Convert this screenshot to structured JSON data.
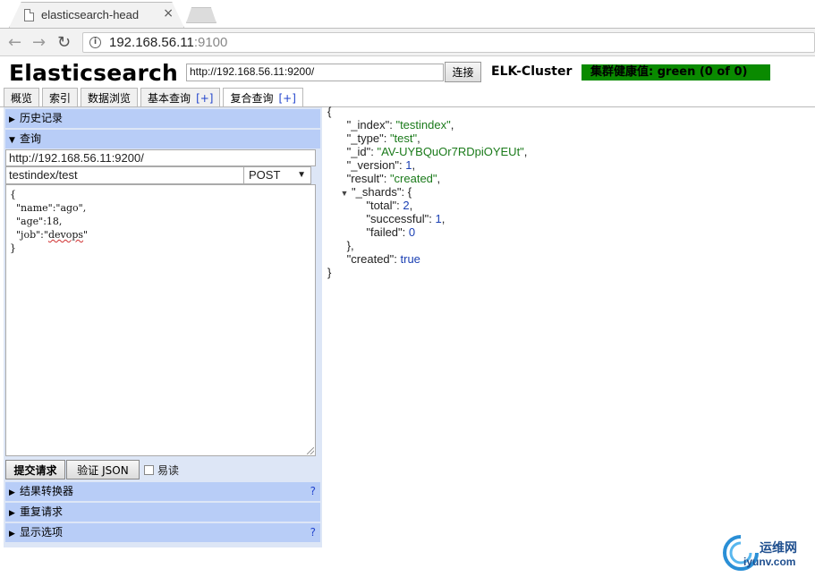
{
  "browser": {
    "tab_title": "elasticsearch-head",
    "tab_close": "×",
    "url_host": "192.168.56.11",
    "url_port": ":9100"
  },
  "header": {
    "app_title": "Elasticsearch",
    "cluster_url": "http://192.168.56.11:9200/",
    "connect_label": "连接",
    "cluster_name": "ELK-Cluster",
    "health": "集群健康值: green (0 of 0)",
    "health_color": "#0a8a00"
  },
  "tabs": [
    {
      "label": "概览"
    },
    {
      "label": "索引"
    },
    {
      "label": "数据浏览"
    },
    {
      "label": "基本查询",
      "plus": "[+]"
    },
    {
      "label": "复合查询",
      "plus": "[+]"
    }
  ],
  "left": {
    "history_label": "历史记录",
    "query_label": "查询",
    "request_url": "http://192.168.56.11:9200/",
    "request_path": "testindex/test",
    "method": "POST",
    "body_lines": [
      "{",
      "  \"name\":\"ago\",",
      "  \"age\":18,",
      "  \"job\":\"",
      "devops",
      "\"",
      "}"
    ],
    "submit_label": "提交请求",
    "validate_label": "验证 JSON",
    "easy_read_label": "易读",
    "result_transformer_label": "结果转换器",
    "repeat_label": "重复请求",
    "display_options_label": "显示选项",
    "help": "?"
  },
  "response": {
    "open": "{",
    "index_key": "\"_index\"",
    "index_val": "\"testindex\"",
    "type_key": "\"_type\"",
    "type_val": "\"test\"",
    "id_key": "\"_id\"",
    "id_val": "\"AV-UYBQuOr7RDpiOYEUt\"",
    "version_key": "\"_version\"",
    "version_val": "1",
    "result_key": "\"result\"",
    "result_val": "\"created\"",
    "shards_key": "\"_shards\"",
    "total_key": "\"total\"",
    "total_val": "2",
    "successful_key": "\"successful\"",
    "successful_val": "1",
    "failed_key": "\"failed\"",
    "failed_val": "0",
    "shards_close": "},",
    "created_key": "\"created\"",
    "created_val": "true",
    "close": "}"
  },
  "watermark": {
    "cn": "运维网",
    "en": "iyunv.com"
  }
}
